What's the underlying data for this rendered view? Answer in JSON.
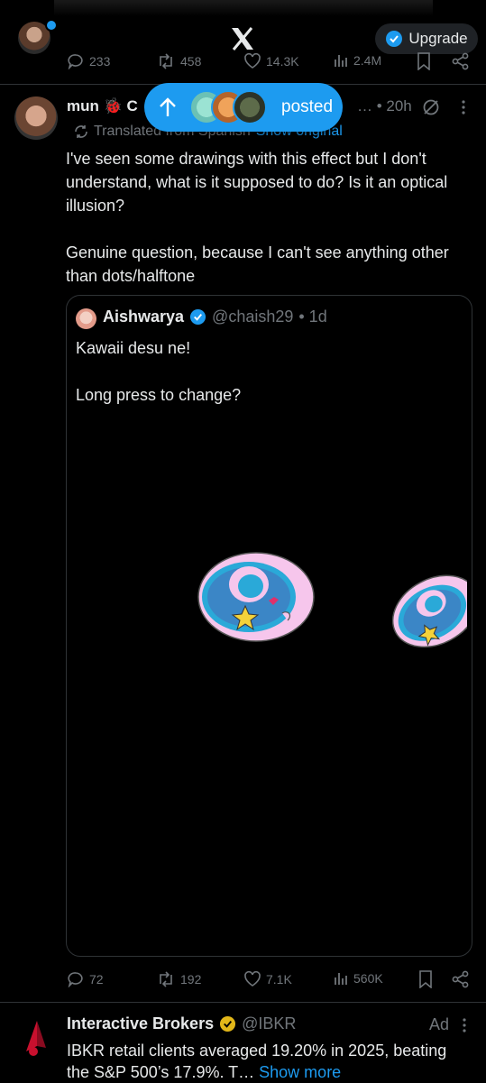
{
  "header": {
    "upgrade_label": "Upgrade",
    "accent": "#1d9bf0"
  },
  "prev_post_actions": {
    "replies": "233",
    "reposts": "458",
    "likes": "14.3K",
    "views": "2.4M"
  },
  "post": {
    "author_name": "mun 🐞 C",
    "time": "… • 20h",
    "translated_label": "Translated from Spanish",
    "show_original": "Show original",
    "text": "I've seen some drawings with this effect but I don't understand, what is it supposed to do? Is it an optical illusion?\n\nGenuine question, because I can't see anything other than dots/halftone",
    "posted_pill_label": "posted",
    "quote": {
      "author_name": "Aishwarya",
      "handle": "@chaish29",
      "time": "• 1d",
      "text": "Kawaii desu ne!\n\nLong press to change?"
    },
    "actions": {
      "replies": "72",
      "reposts": "192",
      "likes": "7.1K",
      "views": "560K"
    }
  },
  "ad": {
    "author_name": "Interactive Brokers",
    "handle": "@IBKR",
    "ad_label": "Ad",
    "text": "IBKR retail clients averaged 19.20% in 2025, beating the S&P 500’s 17.9%. T…",
    "show_more": "Show more"
  }
}
